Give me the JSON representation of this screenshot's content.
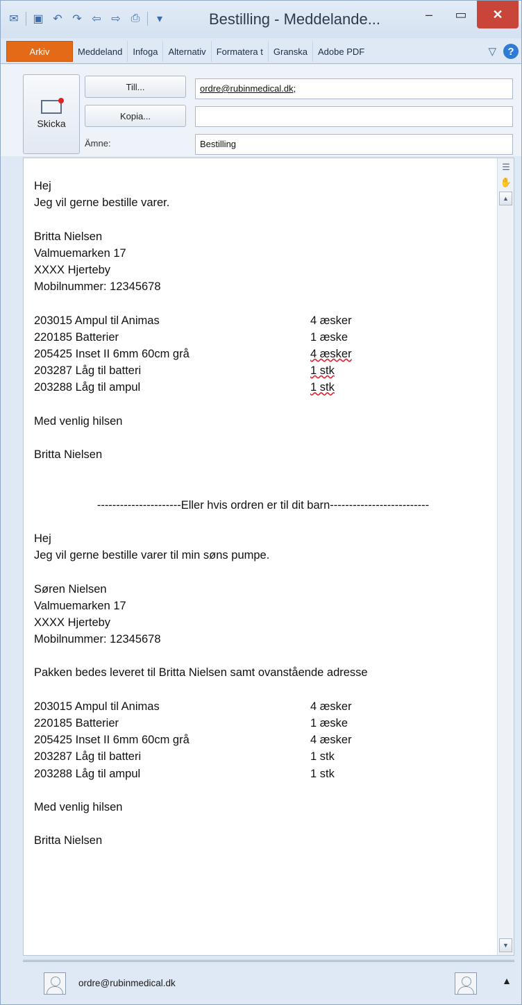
{
  "window": {
    "title": "Bestilling - Meddelande...",
    "minimize_icon": "minimize-icon",
    "maximize_icon": "maximize-icon",
    "close_icon": "close-icon"
  },
  "quick_access": [
    "outlook-icon",
    "save-icon",
    "undo-icon",
    "redo-icon",
    "previous-icon",
    "next-icon",
    "print-icon",
    "customize-icon"
  ],
  "ribbon": {
    "tabs": [
      "Arkiv",
      "Meddeland",
      "Infoga",
      "Alternativ",
      "Formatera t",
      "Granska",
      "Adobe PDF"
    ],
    "accent": "#e56a17"
  },
  "compose": {
    "send_label": "Skicka",
    "to_label": "Till...",
    "cc_label": "Kopia...",
    "subject_label": "Ämne:",
    "to_value": "ordre@rubinmedical.dk;",
    "cc_value": "",
    "subject_value": "Bestilling"
  },
  "body": {
    "block1": {
      "greeting": "Hej",
      "intro": "Jeg vil gerne bestille varer.",
      "name": "Britta Nielsen",
      "street": "Valmuemarken 17",
      "city": "XXXX Hjerteby",
      "phone": "Mobilnummer: 12345678",
      "items": [
        {
          "desc": "203015 Ampul til Animas",
          "qty": "4 æsker"
        },
        {
          "desc": "220185 Batterier",
          "qty": "1 æske"
        },
        {
          "desc": "205425 Inset II 6mm 60cm grå",
          "qty": "4 æsker"
        },
        {
          "desc": "203287 Låg til batteri",
          "qty": "1 stk"
        },
        {
          "desc": "203288 Låg til ampul",
          "qty": "1 stk"
        }
      ],
      "closing": "Med venlig hilsen",
      "signature": "Britta Nielsen"
    },
    "divider": "----------------------Eller hvis ordren er til dit barn--------------------------",
    "block2": {
      "greeting": "Hej",
      "intro": "Jeg vil gerne bestille varer til min søns pumpe.",
      "name": "Søren Nielsen",
      "street": "Valmuemarken 17",
      "city": "XXXX Hjerteby",
      "phone": "Mobilnummer: 12345678",
      "delivery": "Pakken bedes leveret til Britta Nielsen samt ovanstående adresse",
      "items": [
        {
          "desc": "203015 Ampul til Animas",
          "qty": "4 æsker"
        },
        {
          "desc": "220185 Batterier",
          "qty": "1 æske"
        },
        {
          "desc": "205425 Inset II 6mm 60cm grå",
          "qty": "4 æsker"
        },
        {
          "desc": "203287 Låg til batteri",
          "qty": "1 stk"
        },
        {
          "desc": "203288 Låg til ampul",
          "qty": "1 stk"
        }
      ],
      "closing": "Med venlig hilsen",
      "signature": "Britta Nielsen"
    }
  },
  "people_pane": {
    "email": "ordre@rubinmedical.dk"
  }
}
